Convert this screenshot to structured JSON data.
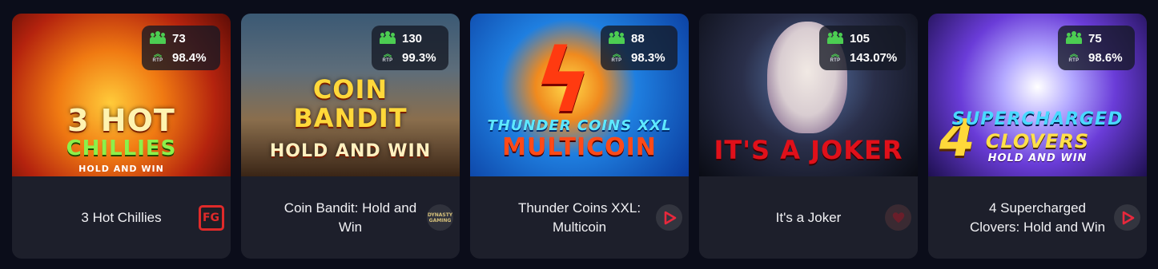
{
  "games": [
    {
      "title": "3 Hot Chillies",
      "players": "73",
      "rtp": "98.4%",
      "rtp_icon_label": "RTP",
      "provider_icon": "fg-provider-icon",
      "provider_text": "FG",
      "art_text": [
        "3 HOT",
        "CHILLIES",
        "HOLD AND WIN"
      ]
    },
    {
      "title": "Coin Bandit: Hold and Win",
      "players": "130",
      "rtp": "99.3%",
      "rtp_icon_label": "RTP",
      "provider_icon": "dynasty-provider-icon",
      "provider_text": "DYNASTY GAMING",
      "art_text": [
        "COIN",
        "BANDIT",
        "HOLD AND WIN"
      ]
    },
    {
      "title": "Thunder Coins XXL: Multicoin",
      "players": "88",
      "rtp": "98.3%",
      "rtp_icon_label": "RTP",
      "provider_icon": "play-provider-icon",
      "art_text": [
        "THUNDER COINS XXL",
        "MULTICOIN"
      ]
    },
    {
      "title": "It's a Joker",
      "players": "105",
      "rtp": "143.07%",
      "rtp_icon_label": "RTP",
      "provider_icon": "heart-provider-icon",
      "art_text": [
        "IT'S A JOKER"
      ]
    },
    {
      "title": "4 Supercharged Clovers: Hold and Win",
      "players": "75",
      "rtp": "98.6%",
      "rtp_icon_label": "RTP",
      "provider_icon": "play-provider-icon",
      "art_text": [
        "4",
        "SUPERCHARGED",
        "CLOVERS",
        "HOLD AND WIN"
      ]
    }
  ],
  "colors": {
    "page_bg": "#0b0d1a",
    "card_bg": "#1d1f2b",
    "accent_green": "#4ccd52",
    "provider_red": "#e02a2a"
  }
}
